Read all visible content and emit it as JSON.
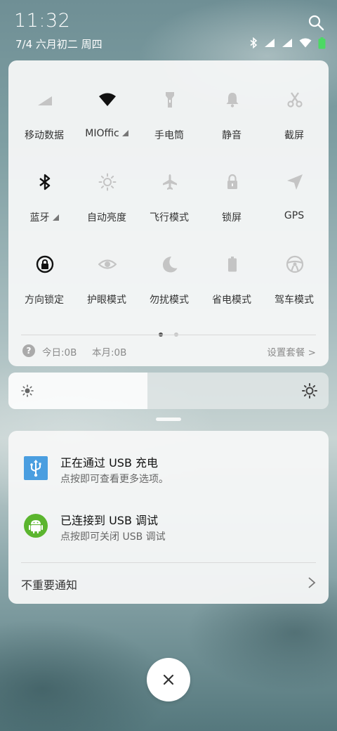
{
  "status_bar": {
    "time": "11:32",
    "date": "7/4 六月初二 周四",
    "icons": [
      "bluetooth-icon",
      "signal-icon",
      "signal-icon",
      "wifi-icon",
      "battery-icon"
    ]
  },
  "quick_settings": {
    "tiles": [
      {
        "label": "移动数据",
        "icon": "mobile-data-icon",
        "active": false
      },
      {
        "label": "MIOffic",
        "icon": "wifi-icon",
        "active": true,
        "has_more": true
      },
      {
        "label": "手电筒",
        "icon": "flashlight-icon",
        "active": false
      },
      {
        "label": "静音",
        "icon": "bell-icon",
        "active": false
      },
      {
        "label": "截屏",
        "icon": "scissors-icon",
        "active": false
      },
      {
        "label": "蓝牙",
        "icon": "bluetooth-icon",
        "active": true,
        "has_more": true
      },
      {
        "label": "自动亮度",
        "icon": "auto-brightness-icon",
        "active": false
      },
      {
        "label": "飞行模式",
        "icon": "airplane-icon",
        "active": false
      },
      {
        "label": "锁屏",
        "icon": "lock-icon",
        "active": false
      },
      {
        "label": "GPS",
        "icon": "gps-icon",
        "active": false
      },
      {
        "label": "方向锁定",
        "icon": "rotation-lock-icon",
        "active": true
      },
      {
        "label": "护眼模式",
        "icon": "eye-icon",
        "active": false
      },
      {
        "label": "勿扰模式",
        "icon": "moon-icon",
        "active": false
      },
      {
        "label": "省电模式",
        "icon": "battery-saver-icon",
        "active": false
      },
      {
        "label": "驾车模式",
        "icon": "steering-wheel-icon",
        "active": false
      }
    ],
    "page_count": 2,
    "current_page": 1,
    "data_usage": {
      "today": "今日:0B",
      "month": "本月:0B",
      "plan_link": "设置套餐 >"
    }
  },
  "brightness": {
    "level": 0.435
  },
  "notifications": [
    {
      "title": "正在通过 USB 充电",
      "subtitle": "点按即可查看更多选项。",
      "icon": "usb-icon",
      "icon_color": "#4a9ee0"
    },
    {
      "title": "已连接到 USB 调试",
      "subtitle": "点按即可关闭 USB 调试",
      "icon": "android-icon",
      "icon_color": "#5bb52e"
    }
  ],
  "unimportant_label": "不重要通知",
  "colors": {
    "panel_bg": "#f6f7f7",
    "active_icon": "#111111",
    "inactive_icon": "#bcbcbc"
  }
}
